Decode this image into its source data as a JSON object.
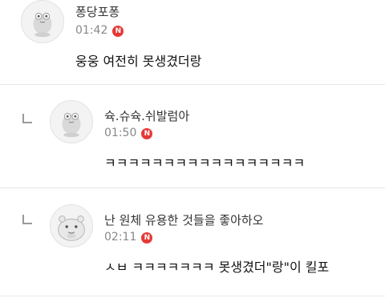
{
  "comments": [
    {
      "nickname": "퐁당포퐁",
      "time": "01:42",
      "badge": "N",
      "text": "웅웅 여전히 못생겼더랑",
      "avatar_icon": "default-profile-icon"
    },
    {
      "nickname": "슉.슈슉.쉬발럼아",
      "time": "01:50",
      "badge": "N",
      "text": "ㅋㅋㅋㅋㅋㅋㅋㅋㅋㅋㅋㅋㅋㅋㅋㅋㅋ",
      "avatar_icon": "default-profile-icon",
      "is_reply": true
    },
    {
      "nickname": "난 원체 유용한 것들을 좋아하오",
      "time": "02:11",
      "badge": "N",
      "text": "ㅅㅂ ㅋㅋㅋㅋㅋㅋㅋ 못생겼더\"랑\"이 킬포",
      "avatar_icon": "hamster-profile-icon",
      "is_reply": true
    }
  ],
  "colors": {
    "badge": "#e53935",
    "divider": "#e6e6e6",
    "meta": "#888888"
  }
}
